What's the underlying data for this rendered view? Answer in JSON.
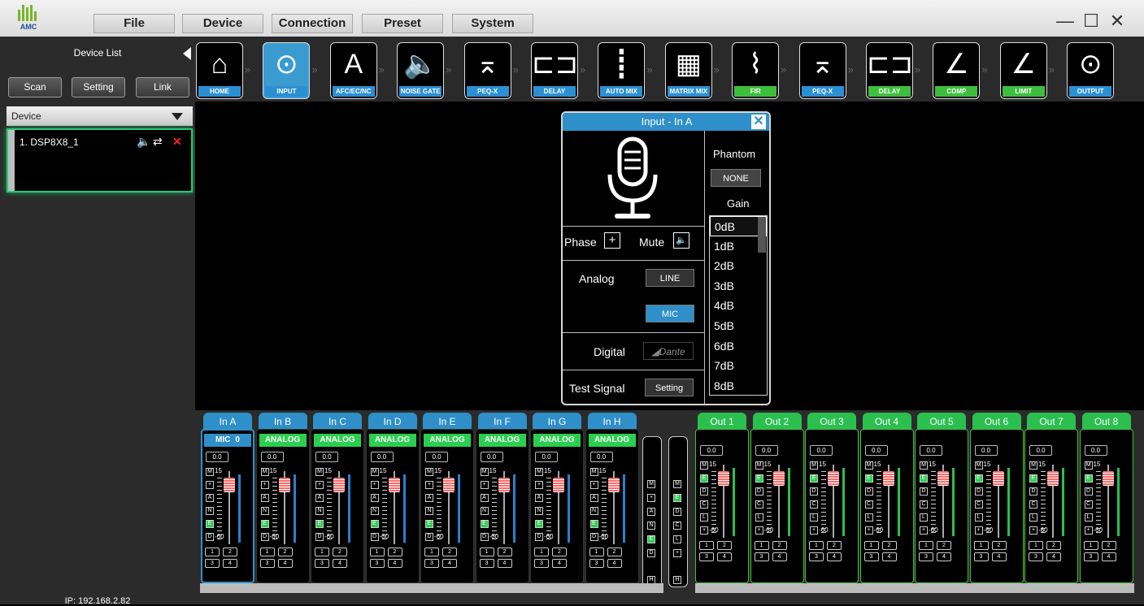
{
  "app": {
    "logo_text": "AMC"
  },
  "menu": [
    "File",
    "Device",
    "Connection",
    "Preset",
    "System"
  ],
  "window": {
    "minimize": "—",
    "maximize": "☐",
    "close": "✕"
  },
  "sidebar": {
    "title": "Device List",
    "buttons": [
      "Scan",
      "Setting",
      "Link"
    ],
    "device_header": "Device",
    "devices": [
      {
        "name": "1. DSP8X8_1"
      }
    ],
    "status_ip": "IP: 192.168.2.82"
  },
  "toolbar": [
    {
      "label": "HOME",
      "icon": "home-icon",
      "style": "blue"
    },
    {
      "label": "INPUT",
      "icon": "xlr-icon",
      "style": "selected"
    },
    {
      "label": "AFC/EC/NC",
      "icon": "letter-a-icon",
      "style": "blue"
    },
    {
      "label": "NOISE GATE",
      "icon": "speaker-icon",
      "style": "blue"
    },
    {
      "label": "PEQ-X",
      "icon": "peq-icon",
      "style": "blue"
    },
    {
      "label": "DELAY",
      "icon": "delay-icon",
      "style": "blue"
    },
    {
      "label": "AUTO MIX",
      "icon": "faders-icon",
      "style": "blue"
    },
    {
      "label": "MATRIX MIX",
      "icon": "matrix-icon",
      "style": "blue"
    },
    {
      "label": "FIR",
      "icon": "fir-icon",
      "style": "green"
    },
    {
      "label": "PEQ-X",
      "icon": "peq-icon",
      "style": "blue"
    },
    {
      "label": "DELAY",
      "icon": "delay-icon",
      "style": "green"
    },
    {
      "label": "COMP",
      "icon": "comp-icon",
      "style": "green"
    },
    {
      "label": "LIMIT",
      "icon": "limit-icon",
      "style": "green"
    },
    {
      "label": "OUTPUT",
      "icon": "xlr-icon",
      "style": "blue"
    }
  ],
  "dialog": {
    "title": "Input - In A",
    "phantom_label": "Phantom",
    "phantom_value": "NONE",
    "gain_label": "Gain",
    "gain_options": [
      "0dB",
      "1dB",
      "2dB",
      "3dB",
      "4dB",
      "5dB",
      "6dB",
      "7dB",
      "8dB"
    ],
    "gain_selected": "0dB",
    "phase_label": "Phase",
    "phase_button": "+",
    "mute_label": "Mute",
    "analog_label": "Analog",
    "analog_line": "LINE",
    "analog_mic": "MIC",
    "digital_label": "Digital",
    "digital_value": "Dante",
    "test_label": "Test Signal",
    "test_button": "Setting"
  },
  "mixer": {
    "inputs": [
      {
        "name": "In A",
        "mode": "MIC",
        "gain_badge": "0",
        "value": "0.0",
        "max": "15",
        "min": "-60"
      },
      {
        "name": "In B",
        "mode": "ANALOG",
        "value": "0.0",
        "max": "15",
        "min": "-60"
      },
      {
        "name": "In C",
        "mode": "ANALOG",
        "value": "0.0",
        "max": "15",
        "min": "-60"
      },
      {
        "name": "In D",
        "mode": "ANALOG",
        "value": "0.0",
        "max": "15",
        "min": "-60"
      },
      {
        "name": "In E",
        "mode": "ANALOG",
        "value": "0.0",
        "max": "15",
        "min": "-60"
      },
      {
        "name": "In F",
        "mode": "ANALOG",
        "value": "0.0",
        "max": "15",
        "min": "-60"
      },
      {
        "name": "In G",
        "mode": "ANALOG",
        "value": "0.0",
        "max": "15",
        "min": "-60"
      },
      {
        "name": "In H",
        "mode": "ANALOG",
        "value": "0.0",
        "max": "15",
        "min": "-60"
      }
    ],
    "outputs": [
      {
        "name": "Out 1",
        "value": "0.0",
        "max": "15",
        "min": "-60"
      },
      {
        "name": "Out 2",
        "value": "0.0",
        "max": "15",
        "min": "-60"
      },
      {
        "name": "Out 3",
        "value": "0.0",
        "max": "15",
        "min": "-60"
      },
      {
        "name": "Out 4",
        "value": "0.0",
        "max": "15",
        "min": "-60"
      },
      {
        "name": "Out 5",
        "value": "0.0",
        "max": "15",
        "min": "-60"
      },
      {
        "name": "Out 6",
        "value": "0.0",
        "max": "15",
        "min": "-60"
      },
      {
        "name": "Out 7",
        "value": "0.0",
        "max": "15",
        "min": "-60"
      },
      {
        "name": "Out 8",
        "value": "0.0",
        "max": "15",
        "min": "-60"
      }
    ],
    "in_buttons": [
      "M",
      "+",
      "A",
      "N",
      "E",
      "D"
    ],
    "out_buttons": [
      "M",
      "E",
      "D",
      "C",
      "L",
      "+"
    ],
    "nums": [
      "1",
      "2",
      "3",
      "4"
    ],
    "master_in": [
      "M",
      "+",
      "A",
      "N",
      "E",
      "D",
      "H"
    ],
    "master_out": [
      "M",
      "E",
      "D",
      "C",
      "L",
      "+",
      "H"
    ]
  }
}
